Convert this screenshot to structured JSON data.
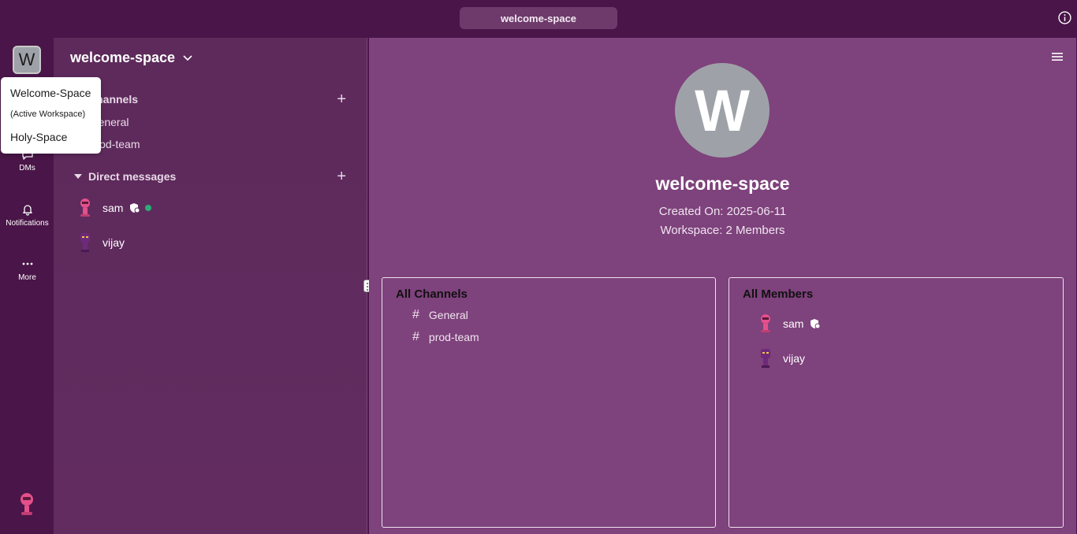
{
  "topbar": {
    "search_label": "welcome-space"
  },
  "rail": {
    "workspace_initial": "W",
    "items": [
      {
        "label": "DMs",
        "icon": "dm-icon"
      },
      {
        "label": "Notifications",
        "icon": "bell-icon"
      },
      {
        "label": "More",
        "icon": "more-icon"
      }
    ]
  },
  "dropdown": {
    "items": [
      {
        "label": "Welcome-Space"
      },
      {
        "label": "(Active Workspace)"
      },
      {
        "label": "Holy-Space"
      }
    ]
  },
  "sidebar": {
    "workspace_name": "welcome-space",
    "channels_header": "Channels",
    "channels": [
      "General",
      "prod-team"
    ],
    "dm_header": "Direct messages",
    "dms": [
      {
        "name": "sam",
        "admin": true,
        "online": true
      },
      {
        "name": "vijay",
        "admin": false,
        "online": false
      }
    ]
  },
  "main": {
    "avatar_initial": "W",
    "title": "welcome-space",
    "created_on": "Created On: 2025-06-11",
    "members_line": "Workspace: 2 Members",
    "channels_panel": {
      "title": "All Channels",
      "items": [
        "General",
        "prod-team"
      ]
    },
    "members_panel": {
      "title": "All Members",
      "items": [
        "sam",
        "vijay"
      ]
    }
  },
  "colors": {
    "topbar": "#4a1548",
    "sidebar": "#5d2a5b",
    "main": "#7e427c",
    "online": "#2bac76"
  }
}
